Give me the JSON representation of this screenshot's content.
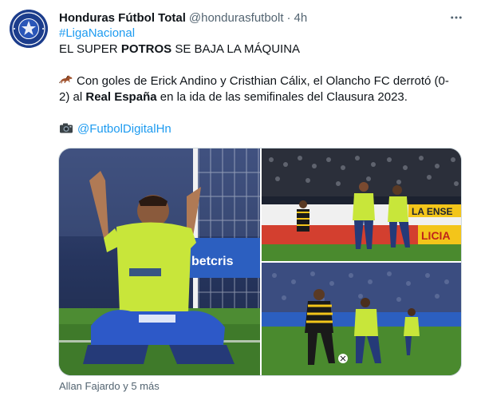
{
  "tweet": {
    "author": {
      "display_name": "Honduras Fútbol Total",
      "handle": "@hondurasfutbolt",
      "time": "4h",
      "avatar_text": "HONDURAS FÚTBOL TOTAL"
    },
    "hashtag": "#LigaNacional",
    "headline": {
      "part1": "EL SUPER ",
      "bold": "POTROS",
      "part2": " SE BAJA LA MÁQUINA"
    },
    "body_line1": "Con goles de Erick Andino y Cristhian Cálix, el Olancho FC derrotó (0-",
    "body_line2": {
      "part1": "2) al ",
      "bold": "Real España",
      "part2": " en la ida de las semifinales del Clausura 2023."
    },
    "mention": "@FutbolDigitalHn",
    "photo_caption": "Allan Fajardo y 5 más",
    "icons": {
      "horse": "horse-emoji-icon",
      "camera": "camera-emoji-icon",
      "more": "more-options-icon"
    },
    "photo_texts": {
      "banner1": "betcris",
      "banner2": "LA ENSE",
      "banner3": "LICIA"
    }
  }
}
